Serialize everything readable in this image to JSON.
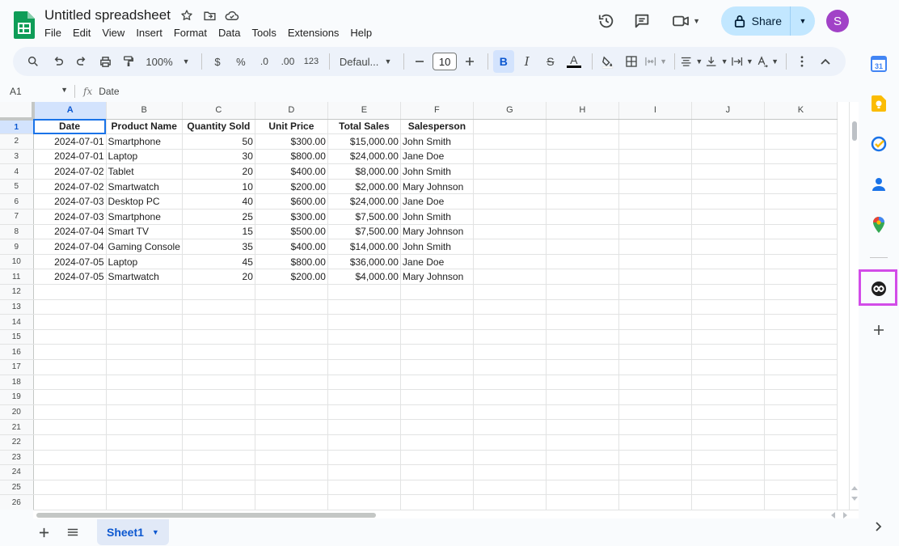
{
  "header": {
    "title": "Untitled spreadsheet",
    "menu": [
      "File",
      "Edit",
      "View",
      "Insert",
      "Format",
      "Data",
      "Tools",
      "Extensions",
      "Help"
    ],
    "share_label": "Share",
    "avatar_letter": "S"
  },
  "toolbar": {
    "zoom": "100%",
    "currency": "$",
    "percent": "%",
    "dec_decrease": ".0",
    "dec_increase": ".00",
    "number_format": "123",
    "font": "Defaul...",
    "font_size": "10",
    "bold": "B",
    "italic": "I",
    "strike": "S",
    "text_color": "A"
  },
  "formula_bar": {
    "cell_ref": "A1",
    "fx": "fx",
    "content": "Date"
  },
  "grid": {
    "columns": [
      "A",
      "B",
      "C",
      "D",
      "E",
      "F",
      "G",
      "H",
      "I",
      "J",
      "K"
    ],
    "headers": [
      "Date",
      "Product Name",
      "Quantity Sold",
      "Unit Price",
      "Total Sales",
      "Salesperson"
    ],
    "rows": [
      [
        "2024-07-01",
        "Smartphone",
        "50",
        "$300.00",
        "$15,000.00",
        "John Smith"
      ],
      [
        "2024-07-01",
        "Laptop",
        "30",
        "$800.00",
        "$24,000.00",
        "Jane Doe"
      ],
      [
        "2024-07-02",
        "Tablet",
        "20",
        "$400.00",
        "$8,000.00",
        "John Smith"
      ],
      [
        "2024-07-02",
        "Smartwatch",
        "10",
        "$200.00",
        "$2,000.00",
        "Mary Johnson"
      ],
      [
        "2024-07-03",
        "Desktop PC",
        "40",
        "$600.00",
        "$24,000.00",
        "Jane Doe"
      ],
      [
        "2024-07-03",
        "Smartphone",
        "25",
        "$300.00",
        "$7,500.00",
        "John Smith"
      ],
      [
        "2024-07-04",
        "Smart TV",
        "15",
        "$500.00",
        "$7,500.00",
        "Mary Johnson"
      ],
      [
        "2024-07-04",
        "Gaming Console",
        "35",
        "$400.00",
        "$14,000.00",
        "John Smith"
      ],
      [
        "2024-07-05",
        "Laptop",
        "45",
        "$800.00",
        "$36,000.00",
        "Jane Doe"
      ],
      [
        "2024-07-05",
        "Smartwatch",
        "20",
        "$200.00",
        "$4,000.00",
        "Mary Johnson"
      ]
    ],
    "total_rows": 26
  },
  "bottom": {
    "sheet_tab": "Sheet1"
  },
  "side_panel": {
    "calendar_day": "31"
  },
  "colors": {
    "accent": "#0b57d0",
    "share_bg": "#c2e7ff",
    "avatar": "#a142c7",
    "highlight": "#d24ce8",
    "sheets_green": "#0f9d58"
  }
}
